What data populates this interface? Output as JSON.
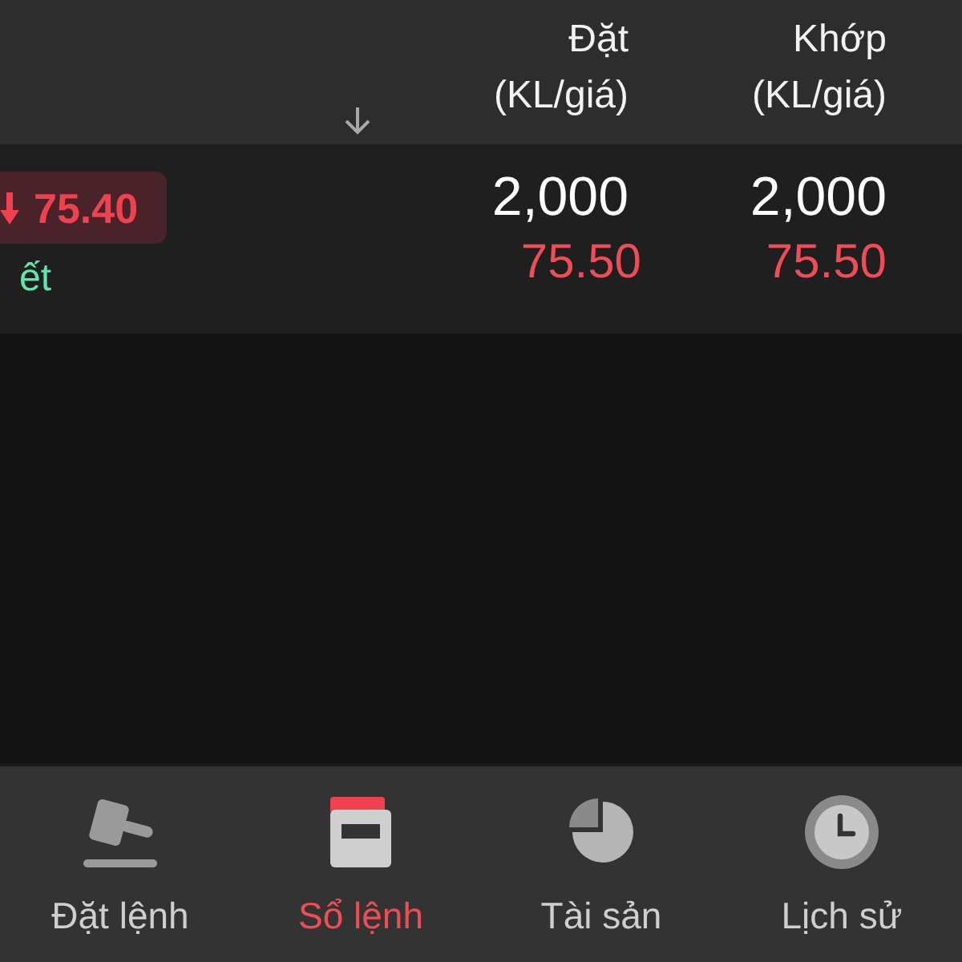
{
  "table": {
    "columns": [
      {
        "title": "Đặt",
        "subtitle": "(KL/giá)"
      },
      {
        "title": "Khớp",
        "subtitle": "(KL/giá)"
      }
    ],
    "rows": [
      {
        "price_badge": {
          "falling": true,
          "text": "75.40"
        },
        "status": "ết",
        "order": {
          "volume": "2,000",
          "price": "75.50"
        },
        "matched": {
          "volume": "2,000",
          "price": "75.50"
        }
      }
    ]
  },
  "bottom_nav": {
    "items": [
      {
        "label": "Đặt lệnh",
        "selected": false
      },
      {
        "label": "Sổ lệnh",
        "selected": true
      },
      {
        "label": "Tài sản",
        "selected": false
      },
      {
        "label": "Lịch sử",
        "selected": false
      }
    ]
  }
}
